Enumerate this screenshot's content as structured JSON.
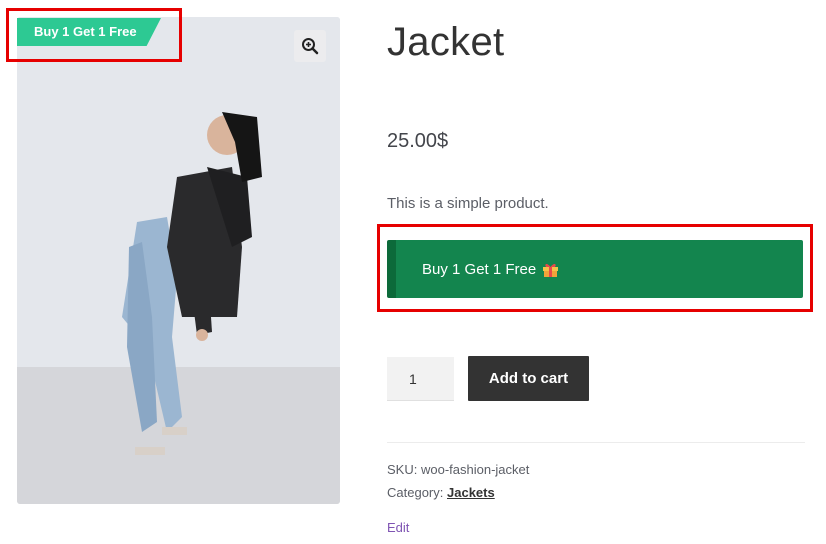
{
  "product": {
    "title": "Jacket",
    "price": "25.00$",
    "short_description": "This is a simple product."
  },
  "badge": {
    "label": "Buy 1 Get 1 Free",
    "color": "#2dc993"
  },
  "bogo_button": {
    "label": "Buy 1 Get 1 Free",
    "icon": "gift-icon",
    "color": "#13854e"
  },
  "cart": {
    "quantity": "1",
    "add_label": "Add to cart"
  },
  "meta": {
    "sku_label": "SKU:",
    "sku_value": "woo-fashion-jacket",
    "category_label": "Category:",
    "category_value": "Jackets",
    "edit_label": "Edit"
  },
  "icons": {
    "zoom": "zoom-in-icon"
  },
  "highlight_color": "#e60000"
}
